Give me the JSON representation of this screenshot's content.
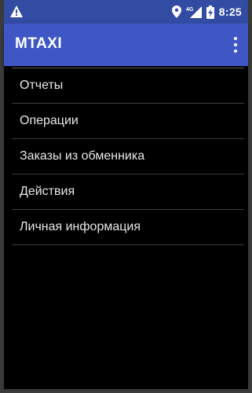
{
  "status_bar": {
    "time": "8:25",
    "network_label": "4G",
    "icons": [
      "warning-icon",
      "location-icon",
      "signal-icon",
      "battery-charging-icon"
    ]
  },
  "app_bar": {
    "title": "MTAXI",
    "overflow_icon": "overflow-menu-icon"
  },
  "menu": {
    "items": [
      {
        "label": "Отчеты"
      },
      {
        "label": "Операции"
      },
      {
        "label": "Заказы из обменника"
      },
      {
        "label": "Действия"
      },
      {
        "label": "Личная информация"
      }
    ]
  },
  "colors": {
    "status_bar": "#324ba3",
    "app_bar": "#3f57c6",
    "background": "#000000",
    "text": "#e8e8e8",
    "divider": "#3c3c3c"
  }
}
